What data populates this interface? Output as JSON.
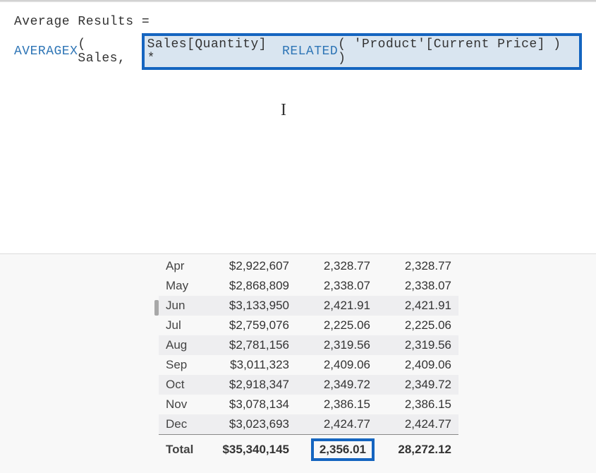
{
  "formula": {
    "line1": "Average Results =",
    "fn1": "AVERAGEX",
    "open": "( Sales, ",
    "highlighted_pre": "Sales[Quantity] * ",
    "fn2": "RELATED",
    "highlighted_post": "( 'Product'[Current Price] ) )",
    "close": ")"
  },
  "table": {
    "rows": [
      {
        "month": "Apr",
        "amount": "$2,922,607",
        "v1": "2,328.77",
        "v2": "2,328.77",
        "striped": false
      },
      {
        "month": "May",
        "amount": "$2,868,809",
        "v1": "2,338.07",
        "v2": "2,338.07",
        "striped": false
      },
      {
        "month": "Jun",
        "amount": "$3,133,950",
        "v1": "2,421.91",
        "v2": "2,421.91",
        "striped": true
      },
      {
        "month": "Jul",
        "amount": "$2,759,076",
        "v1": "2,225.06",
        "v2": "2,225.06",
        "striped": false
      },
      {
        "month": "Aug",
        "amount": "$2,781,156",
        "v1": "2,319.56",
        "v2": "2,319.56",
        "striped": true
      },
      {
        "month": "Sep",
        "amount": "$3,011,323",
        "v1": "2,409.06",
        "v2": "2,409.06",
        "striped": false
      },
      {
        "month": "Oct",
        "amount": "$2,918,347",
        "v1": "2,349.72",
        "v2": "2,349.72",
        "striped": true
      },
      {
        "month": "Nov",
        "amount": "$3,078,134",
        "v1": "2,386.15",
        "v2": "2,386.15",
        "striped": false
      },
      {
        "month": "Dec",
        "amount": "$3,023,693",
        "v1": "2,424.77",
        "v2": "2,424.77",
        "striped": true
      }
    ],
    "total": {
      "label": "Total",
      "amount": "$35,340,145",
      "v1": "2,356.01",
      "v2": "28,272.12"
    }
  }
}
